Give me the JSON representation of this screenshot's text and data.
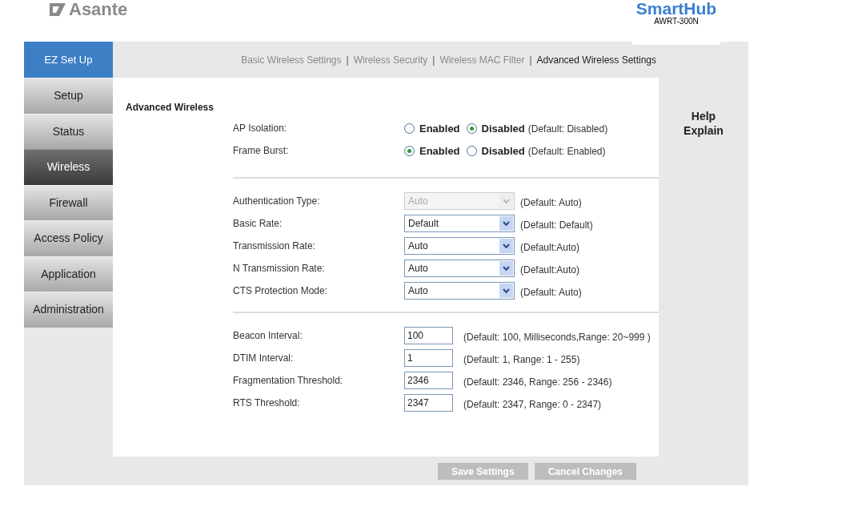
{
  "header": {
    "logo": "Asante",
    "product": "SmartHub",
    "model": "AWRT-300N"
  },
  "sidebar": {
    "ez_setup": "EZ Set Up",
    "items": [
      {
        "label": "Setup",
        "selected": false
      },
      {
        "label": "Status",
        "selected": false
      },
      {
        "label": "Wireless",
        "selected": true
      },
      {
        "label": "Firewall",
        "selected": false
      },
      {
        "label": "Access Policy",
        "selected": false
      },
      {
        "label": "Application",
        "selected": false
      },
      {
        "label": "Administration",
        "selected": false
      }
    ]
  },
  "subtabs": {
    "separator": "|",
    "items": [
      {
        "label": "Basic Wireless Settings",
        "selected": false
      },
      {
        "label": "Wireless Security",
        "selected": false
      },
      {
        "label": "Wireless MAC Filter",
        "selected": false
      },
      {
        "label": "Advanced Wireless Settings",
        "selected": true
      }
    ]
  },
  "section_title": "Advanced Wireless",
  "groups": [
    {
      "rows": [
        {
          "kind": "radio",
          "label": "AP Isolation:",
          "options": [
            {
              "label": "Enabled",
              "selected": false
            },
            {
              "label": "Disabled",
              "selected": true
            }
          ],
          "note": "(Default: Disabled)"
        },
        {
          "kind": "radio",
          "label": "Frame Burst:",
          "options": [
            {
              "label": "Enabled",
              "selected": true
            },
            {
              "label": "Disabled",
              "selected": false
            }
          ],
          "note": "(Default: Enabled)"
        }
      ]
    },
    {
      "rows": [
        {
          "kind": "select",
          "label": "Authentication Type:",
          "value": "Auto",
          "disabled": true,
          "note": "(Default: Auto)"
        },
        {
          "kind": "select",
          "label": "Basic Rate:",
          "value": "Default",
          "disabled": false,
          "note": "(Default: Default)"
        },
        {
          "kind": "select",
          "label": "Transmission Rate:",
          "value": "Auto",
          "disabled": false,
          "note": "(Default:Auto)"
        },
        {
          "kind": "select",
          "label": "N Transmission Rate:",
          "value": "Auto",
          "disabled": false,
          "note": "(Default:Auto)"
        },
        {
          "kind": "select",
          "label": "CTS Protection Mode:",
          "value": "Auto",
          "disabled": false,
          "note": "(Default: Auto)"
        }
      ]
    },
    {
      "rows": [
        {
          "kind": "text",
          "label": "Beacon Interval:",
          "value": "100",
          "note": "(Default: 100, Milliseconds,Range: 20~999 )"
        },
        {
          "kind": "text",
          "label": "DTIM Interval:",
          "value": "1",
          "note": "(Default: 1, Range: 1 - 255)"
        },
        {
          "kind": "text",
          "label": "Fragmentation Threshold:",
          "value": "2346",
          "note": "(Default: 2346, Range: 256 - 2346)"
        },
        {
          "kind": "text",
          "label": "RTS Threshold:",
          "value": "2347",
          "note": "(Default: 2347, Range: 0 - 2347)"
        }
      ]
    }
  ],
  "buttons": [
    "Save Settings",
    "Cancel Changes"
  ],
  "help": {
    "title": "Help",
    "link": "Explain"
  }
}
